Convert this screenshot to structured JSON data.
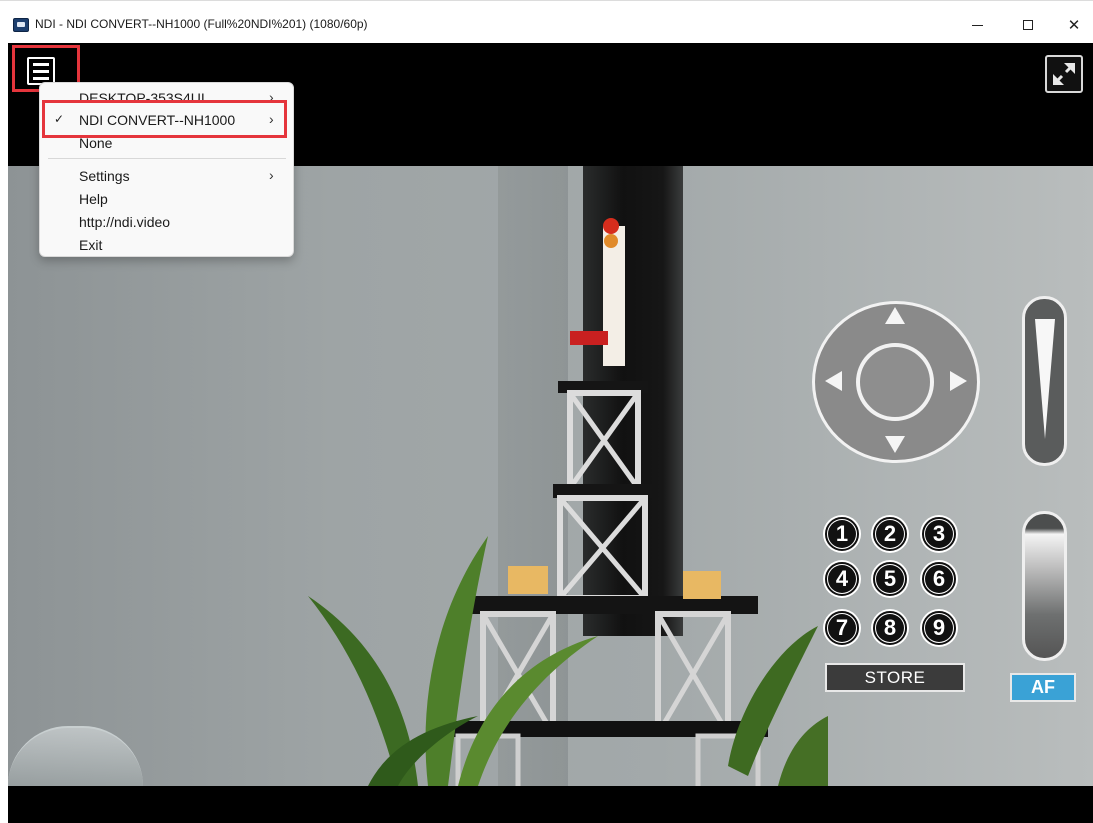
{
  "window": {
    "title": "NDI - NDI CONVERT--NH1000 (Full%20NDI%201) (1080/60p)",
    "icon": "ndi-app-icon",
    "controls": [
      "minimize-icon",
      "maximize-icon",
      "close-icon"
    ]
  },
  "toolbar": {
    "menu_icon": "hamburger-menu-icon",
    "fullscreen_icon": "fullscreen-expand-icon"
  },
  "context_menu": {
    "items": [
      {
        "label": "DESKTOP-353S4UI",
        "has_submenu": true,
        "checked": false
      },
      {
        "label": "NDI CONVERT--NH1000",
        "has_submenu": true,
        "checked": true
      },
      {
        "label": "None",
        "has_submenu": false,
        "checked": false
      },
      {
        "label": "Settings",
        "has_submenu": true,
        "checked": false
      },
      {
        "label": "Help",
        "has_submenu": false,
        "checked": false
      },
      {
        "label": "http://ndi.video",
        "has_submenu": false,
        "checked": false
      },
      {
        "label": "Exit",
        "has_submenu": false,
        "checked": false
      }
    ],
    "check_glyph": "✓",
    "submenu_glyph": "›"
  },
  "ptz": {
    "presets": [
      "1",
      "2",
      "3",
      "4",
      "5",
      "6",
      "7",
      "8",
      "9"
    ],
    "store_label": "STORE",
    "af_label": "AF"
  },
  "colors": {
    "highlight": "#e5353c",
    "af_button": "#3aa2d6"
  }
}
